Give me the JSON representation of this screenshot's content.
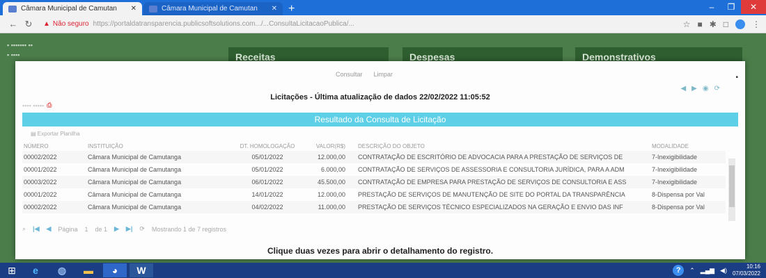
{
  "browser": {
    "tabs": [
      {
        "title": "Câmara Municipal de Camutan",
        "active": true
      },
      {
        "title": "Câmara Municipal de Camutan",
        "active": false
      }
    ],
    "address": {
      "warning": "Não seguro",
      "url": "https://portaldatransparencia.publicsoftsolutions.com.../...ConsultaLicitacaoPublica/..."
    }
  },
  "background": {
    "categories": [
      "Receitas",
      "Despesas",
      "Demonstrativos"
    ]
  },
  "modal": {
    "nav": [
      "Consultar",
      "Limpar"
    ],
    "title": "Licitações - Última atualização de dados 22/02/2022 11:05:52",
    "result_header": "Resultado da Consulta de Licitação",
    "export_label": "Exportar Planilha",
    "columns": [
      "NÚMERO",
      "INSTITUIÇÃO",
      "DT. HOMOLOGAÇÃO",
      "VALOR(R$)",
      "DESCRIÇÃO DO OBJETO",
      "MODALIDADE"
    ],
    "rows": [
      {
        "numero": "00002/2022",
        "instituicao": "Câmara Municipal de Camutanga",
        "data": "05/01/2022",
        "valor": "12.000,00",
        "descricao": "CONTRATAÇÃO DE ESCRITÓRIO DE ADVOCACIA PARA A PRESTAÇÃO DE SERVIÇOS DE",
        "modalidade": "7-Inexigibilidade"
      },
      {
        "numero": "00001/2022",
        "instituicao": "Câmara Municipal de Camutanga",
        "data": "05/01/2022",
        "valor": "6.000,00",
        "descricao": "CONTRATAÇÃO DE SERVIÇOS DE ASSESSORIA E CONSULTORIA JURÍDICA, PARA A ADM",
        "modalidade": "7-Inexigibilidade"
      },
      {
        "numero": "00003/2022",
        "instituicao": "Câmara Municipal de Camutanga",
        "data": "06/01/2022",
        "valor": "45.500,00",
        "descricao": "CONTRATAÇÃO DE EMPRESA PARA PRESTAÇÃO DE SERVIÇOS DE CONSULTORIA E ASS",
        "modalidade": "7-Inexigibilidade"
      },
      {
        "numero": "00001/2022",
        "instituicao": "Câmara Municipal de Camutanga",
        "data": "14/01/2022",
        "valor": "12.000,00",
        "descricao": "PRESTAÇÃO DE SERVIÇOS DE MANUTENÇÃO DE SITE DO PORTAL DA TRANSPARÊNCIA",
        "modalidade": "8-Dispensa por Val"
      },
      {
        "numero": "00002/2022",
        "instituicao": "Câmara Municipal de Camutanga",
        "data": "04/02/2022",
        "valor": "11.000,00",
        "descricao": "PRESTAÇÃO DE SERVIÇOS TÉCNICO ESPECIALIZADOS NA GERAÇÃO E ENVIO DAS INF",
        "modalidade": "8-Dispensa por Val"
      }
    ],
    "pager": {
      "page_label": "Página",
      "page_value": "1",
      "of_label": "de 1",
      "status": "Mostrando 1 de 7 registros"
    },
    "hint": "Clique duas vezes para abrir o detalhamento do registro."
  },
  "taskbar": {
    "time": "10:16",
    "date": "07/03/2022"
  },
  "colors": {
    "accent": "#5dcfe6",
    "browser_bar": "#1f6fd8",
    "taskbar": "#1b3d84"
  }
}
